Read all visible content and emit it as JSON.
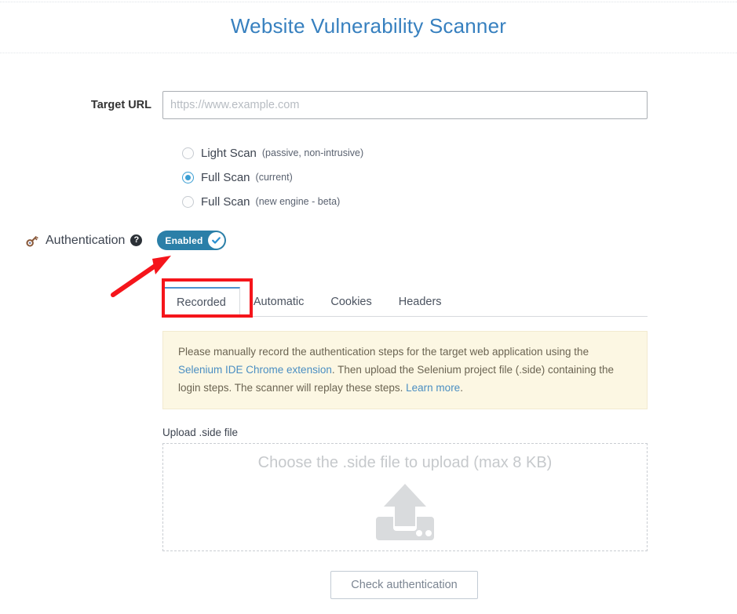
{
  "header": {
    "title": "Website Vulnerability Scanner"
  },
  "target_url": {
    "label": "Target URL",
    "value": "",
    "placeholder": "https://www.example.com"
  },
  "scan_options": [
    {
      "name": "Light Scan",
      "note": "(passive, non-intrusive)",
      "selected": false
    },
    {
      "name": "Full Scan",
      "note": "(current)",
      "selected": true
    },
    {
      "name": "Full Scan",
      "note": "(new engine - beta)",
      "selected": false
    }
  ],
  "authentication": {
    "title": "Authentication",
    "help_icon": "question-mark-icon",
    "key_icon": "key-icon",
    "toggle_label": "Enabled",
    "toggle_state": "on",
    "toggle_color": "#2b7fa8"
  },
  "tabs": [
    {
      "label": "Recorded",
      "active": true
    },
    {
      "label": "Automatic",
      "active": false
    },
    {
      "label": "Cookies",
      "active": false
    },
    {
      "label": "Headers",
      "active": false
    }
  ],
  "info_box": {
    "text_1": "Please manually record the authentication steps for the target web application using the ",
    "link_1": "Selenium IDE Chrome extension",
    "text_2": ". Then upload the Selenium project file (.side) containing the login steps. The scanner will replay these steps. ",
    "link_2": "Learn more",
    "text_3": "."
  },
  "upload": {
    "label": "Upload .side file",
    "dropzone_text": "Choose the .side file to upload (max 8 KB)",
    "icon": "upload-arrow-icon"
  },
  "submit": {
    "label": "Check authentication"
  },
  "annotations": {
    "highlight_color": "#f5151b",
    "rect_target": "Recorded",
    "arrow_target": "Enabled"
  }
}
